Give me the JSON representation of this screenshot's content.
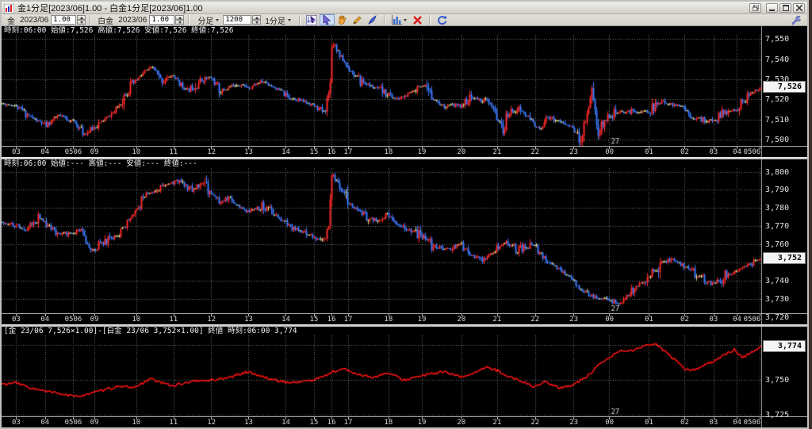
{
  "window": {
    "title": "金1分足[2023/06]1.00 - 白金1分足[2023/06]1.00"
  },
  "toolbar": {
    "gold": {
      "label": "金",
      "month": "2023/06",
      "ratio": "1.00"
    },
    "platinum": {
      "label": "白金",
      "month": "2023/06",
      "ratio": "1.00"
    },
    "chart_type_label": "分足",
    "bar_count": "1200",
    "timeframe_label": "1分足",
    "icons": [
      "data-cursor",
      "select-arrow",
      "hand",
      "pencil",
      "pen",
      "bar-chart",
      "delete-x",
      "refresh",
      "settings-wrench"
    ]
  },
  "colors": {
    "chart_bg": "#000000",
    "grid": "#787878",
    "up": "#ff2a2a",
    "down": "#3d7bff",
    "flat": "#d6d28a",
    "line": "#ee1111",
    "axis_text": "#d8d8d8",
    "current_box_bg": "#f4f4f4"
  },
  "xaxis": {
    "ticks": [
      {
        "f": 0.019,
        "label": "03"
      },
      {
        "f": 0.057,
        "label": "04"
      },
      {
        "f": 0.094,
        "label": "0506"
      },
      {
        "f": 0.122,
        "label": "09"
      },
      {
        "f": 0.177,
        "label": "10"
      },
      {
        "f": 0.226,
        "label": "11"
      },
      {
        "f": 0.276,
        "label": "12"
      },
      {
        "f": 0.325,
        "label": "13"
      },
      {
        "f": 0.374,
        "label": "14"
      },
      {
        "f": 0.411,
        "label": "15"
      },
      {
        "f": 0.434,
        "label": "16"
      },
      {
        "f": 0.456,
        "label": "17"
      },
      {
        "f": 0.509,
        "label": "18"
      },
      {
        "f": 0.553,
        "label": "19"
      },
      {
        "f": 0.605,
        "label": "20"
      },
      {
        "f": 0.652,
        "label": "21"
      },
      {
        "f": 0.702,
        "label": "22"
      },
      {
        "f": 0.753,
        "label": "23"
      },
      {
        "f": 0.8,
        "label": "00"
      },
      {
        "f": 0.852,
        "label": "01"
      },
      {
        "f": 0.899,
        "label": "02"
      },
      {
        "f": 0.937,
        "label": "03"
      },
      {
        "f": 0.968,
        "label": "04"
      },
      {
        "f": 0.998,
        "label": "0506"
      }
    ]
  },
  "chart_data": [
    {
      "id": "gold-1min",
      "type": "candlestick",
      "title": "金1分足[2023/06]",
      "info": "時刻:06:00 始値:7,526 高値:7,526 安値:7,526 終値:7,526",
      "ylim": [
        7497,
        7552
      ],
      "ygrid": [
        7500,
        7510,
        7520,
        7530,
        7540,
        7550
      ],
      "yticks": [
        {
          "v": 7550,
          "label": "7,550"
        },
        {
          "v": 7540,
          "label": "7,540"
        },
        {
          "v": 7530,
          "label": "7,530"
        },
        {
          "v": 7520,
          "label": "7,520"
        },
        {
          "v": 7510,
          "label": "7,510"
        },
        {
          "v": 7500,
          "label": "7,500"
        }
      ],
      "current": {
        "v": 7526,
        "label": "7,526"
      },
      "date_label": {
        "text": "27",
        "f": 0.8
      },
      "vol": 1.0,
      "seed": 11,
      "anchors": [
        [
          0,
          7518
        ],
        [
          0.019,
          7517
        ],
        [
          0.04,
          7511
        ],
        [
          0.06,
          7507
        ],
        [
          0.075,
          7512
        ],
        [
          0.096,
          7509
        ],
        [
          0.11,
          7503
        ],
        [
          0.122,
          7506
        ],
        [
          0.15,
          7514
        ],
        [
          0.165,
          7524
        ],
        [
          0.177,
          7529
        ],
        [
          0.19,
          7534
        ],
        [
          0.2,
          7536
        ],
        [
          0.21,
          7529
        ],
        [
          0.226,
          7532
        ],
        [
          0.245,
          7524
        ],
        [
          0.26,
          7529
        ],
        [
          0.276,
          7531
        ],
        [
          0.29,
          7524
        ],
        [
          0.31,
          7528
        ],
        [
          0.325,
          7526
        ],
        [
          0.345,
          7529
        ],
        [
          0.36,
          7526
        ],
        [
          0.38,
          7521
        ],
        [
          0.4,
          7519
        ],
        [
          0.411,
          7517
        ],
        [
          0.425,
          7514
        ],
        [
          0.432,
          7524
        ],
        [
          0.436,
          7550
        ],
        [
          0.445,
          7543
        ],
        [
          0.456,
          7536
        ],
        [
          0.47,
          7530
        ],
        [
          0.49,
          7526
        ],
        [
          0.509,
          7523
        ],
        [
          0.52,
          7520
        ],
        [
          0.535,
          7522
        ],
        [
          0.55,
          7527
        ],
        [
          0.565,
          7522
        ],
        [
          0.58,
          7517
        ],
        [
          0.605,
          7517
        ],
        [
          0.62,
          7521
        ],
        [
          0.64,
          7519
        ],
        [
          0.652,
          7512
        ],
        [
          0.66,
          7504
        ],
        [
          0.668,
          7513
        ],
        [
          0.68,
          7516
        ],
        [
          0.7,
          7509
        ],
        [
          0.71,
          7504
        ],
        [
          0.72,
          7512
        ],
        [
          0.735,
          7509
        ],
        [
          0.753,
          7506
        ],
        [
          0.762,
          7500
        ],
        [
          0.772,
          7514
        ],
        [
          0.778,
          7527
        ],
        [
          0.785,
          7503
        ],
        [
          0.8,
          7512
        ],
        [
          0.82,
          7514
        ],
        [
          0.852,
          7514
        ],
        [
          0.87,
          7519
        ],
        [
          0.899,
          7516
        ],
        [
          0.91,
          7511
        ],
        [
          0.937,
          7509
        ],
        [
          0.95,
          7513
        ],
        [
          0.968,
          7515
        ],
        [
          0.985,
          7522
        ],
        [
          1,
          7526
        ]
      ]
    },
    {
      "id": "platinum-1min",
      "type": "candlestick",
      "title": "白金1分足[2023/06]",
      "info": "時刻:06:00 始値:--- 高値:--- 安値:--- 終値:---",
      "ylim": [
        3722,
        3802
      ],
      "ygrid": [
        3730,
        3740,
        3750,
        3760,
        3770,
        3780,
        3790,
        3800
      ],
      "yticks": [
        {
          "v": 3800,
          "label": "3,800"
        },
        {
          "v": 3790,
          "label": "3,790"
        },
        {
          "v": 3780,
          "label": "3,780"
        },
        {
          "v": 3770,
          "label": "3,770"
        },
        {
          "v": 3760,
          "label": "3,760"
        },
        {
          "v": 3740,
          "label": "3,740"
        },
        {
          "v": 3730,
          "label": "3,730"
        },
        {
          "v": 3720,
          "label": "3,720"
        }
      ],
      "current": {
        "v": 3752,
        "label": "3,752"
      },
      "date_label": {
        "text": "27",
        "f": 0.8
      },
      "vol": 1.3,
      "seed": 22,
      "anchors": [
        [
          0,
          3772
        ],
        [
          0.019,
          3771
        ],
        [
          0.035,
          3769
        ],
        [
          0.05,
          3775
        ],
        [
          0.06,
          3771
        ],
        [
          0.075,
          3766
        ],
        [
          0.096,
          3766
        ],
        [
          0.105,
          3768
        ],
        [
          0.118,
          3756
        ],
        [
          0.122,
          3758
        ],
        [
          0.14,
          3762
        ],
        [
          0.155,
          3765
        ],
        [
          0.17,
          3774
        ],
        [
          0.177,
          3778
        ],
        [
          0.19,
          3787
        ],
        [
          0.205,
          3790
        ],
        [
          0.22,
          3793
        ],
        [
          0.235,
          3795
        ],
        [
          0.25,
          3790
        ],
        [
          0.265,
          3793
        ],
        [
          0.276,
          3789
        ],
        [
          0.29,
          3783
        ],
        [
          0.3,
          3786
        ],
        [
          0.315,
          3780
        ],
        [
          0.325,
          3778
        ],
        [
          0.345,
          3781
        ],
        [
          0.36,
          3776
        ],
        [
          0.38,
          3770
        ],
        [
          0.4,
          3766
        ],
        [
          0.411,
          3764
        ],
        [
          0.425,
          3761
        ],
        [
          0.432,
          3772
        ],
        [
          0.436,
          3800
        ],
        [
          0.445,
          3792
        ],
        [
          0.456,
          3783
        ],
        [
          0.47,
          3779
        ],
        [
          0.49,
          3773
        ],
        [
          0.509,
          3776
        ],
        [
          0.525,
          3770
        ],
        [
          0.54,
          3767
        ],
        [
          0.553,
          3765
        ],
        [
          0.57,
          3759
        ],
        [
          0.585,
          3757
        ],
        [
          0.605,
          3760
        ],
        [
          0.62,
          3754
        ],
        [
          0.635,
          3751
        ],
        [
          0.652,
          3757
        ],
        [
          0.665,
          3761
        ],
        [
          0.68,
          3757
        ],
        [
          0.7,
          3760
        ],
        [
          0.715,
          3753
        ],
        [
          0.73,
          3748
        ],
        [
          0.753,
          3741
        ],
        [
          0.765,
          3734
        ],
        [
          0.78,
          3731
        ],
        [
          0.8,
          3729
        ],
        [
          0.815,
          3727
        ],
        [
          0.83,
          3734
        ],
        [
          0.852,
          3742
        ],
        [
          0.87,
          3750
        ],
        [
          0.885,
          3752
        ],
        [
          0.899,
          3748
        ],
        [
          0.915,
          3744
        ],
        [
          0.93,
          3739
        ],
        [
          0.937,
          3738
        ],
        [
          0.95,
          3742
        ],
        [
          0.968,
          3745
        ],
        [
          0.985,
          3749
        ],
        [
          1,
          3752
        ]
      ]
    },
    {
      "id": "spread-gold-platinum",
      "type": "line",
      "title": "[金]-[白金] 終値",
      "info": "[金 23/06 7,526×1.00]-[白金 23/06 3,752×1.00] 終値 時刻:06:00 3,774",
      "ylim": [
        3724,
        3782
      ],
      "ygrid": [
        3725,
        3750,
        3775
      ],
      "yticks": [
        {
          "v": 3775,
          "label": "3,775"
        },
        {
          "v": 3750,
          "label": "3,750"
        },
        {
          "v": 3725,
          "label": "3,725"
        }
      ],
      "current": {
        "v": 3774,
        "label": "3,774"
      },
      "date_label": {
        "text": "27",
        "f": 0.8
      },
      "vol": 0.9,
      "seed": 33,
      "anchors": [
        [
          0,
          3747
        ],
        [
          0.019,
          3748
        ],
        [
          0.04,
          3744
        ],
        [
          0.057,
          3742
        ],
        [
          0.08,
          3740
        ],
        [
          0.096,
          3738
        ],
        [
          0.122,
          3741
        ],
        [
          0.15,
          3745
        ],
        [
          0.177,
          3745
        ],
        [
          0.195,
          3751
        ],
        [
          0.21,
          3748
        ],
        [
          0.226,
          3746
        ],
        [
          0.25,
          3749
        ],
        [
          0.276,
          3750
        ],
        [
          0.3,
          3752
        ],
        [
          0.325,
          3756
        ],
        [
          0.345,
          3752
        ],
        [
          0.36,
          3750
        ],
        [
          0.38,
          3748
        ],
        [
          0.411,
          3750
        ],
        [
          0.425,
          3753
        ],
        [
          0.436,
          3756
        ],
        [
          0.45,
          3758
        ],
        [
          0.47,
          3754
        ],
        [
          0.49,
          3752
        ],
        [
          0.509,
          3755
        ],
        [
          0.53,
          3750
        ],
        [
          0.553,
          3753
        ],
        [
          0.58,
          3756
        ],
        [
          0.605,
          3752
        ],
        [
          0.625,
          3756
        ],
        [
          0.64,
          3759
        ],
        [
          0.652,
          3757
        ],
        [
          0.67,
          3752
        ],
        [
          0.69,
          3748
        ],
        [
          0.702,
          3745
        ],
        [
          0.715,
          3749
        ],
        [
          0.735,
          3744
        ],
        [
          0.753,
          3747
        ],
        [
          0.77,
          3752
        ],
        [
          0.785,
          3760
        ],
        [
          0.8,
          3766
        ],
        [
          0.815,
          3771
        ],
        [
          0.83,
          3771
        ],
        [
          0.845,
          3774
        ],
        [
          0.86,
          3776
        ],
        [
          0.875,
          3770
        ],
        [
          0.899,
          3758
        ],
        [
          0.91,
          3757
        ],
        [
          0.925,
          3761
        ],
        [
          0.937,
          3763
        ],
        [
          0.955,
          3769
        ],
        [
          0.965,
          3772
        ],
        [
          0.975,
          3766
        ],
        [
          0.985,
          3769
        ],
        [
          1,
          3774
        ]
      ]
    }
  ]
}
